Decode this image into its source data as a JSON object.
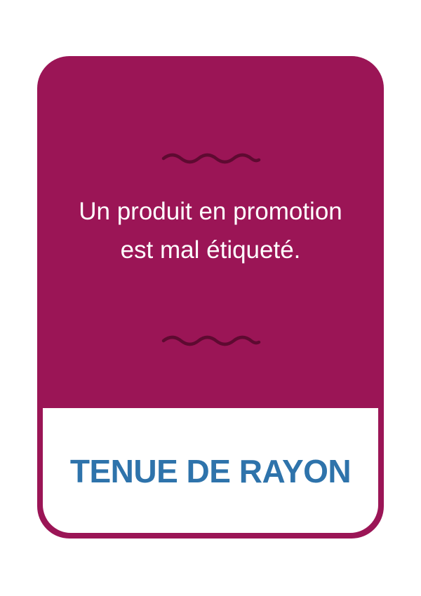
{
  "card": {
    "text": "Un produit en promotion est mal étiqueté.",
    "category": "TENUE DE RAYON",
    "decoration_icon": "wavy-line-icon"
  },
  "colors": {
    "background": "#ffffff",
    "card": "#9b1556",
    "wave": "#5e0a31",
    "text": "#ffffff",
    "category": "#2e73ab"
  }
}
